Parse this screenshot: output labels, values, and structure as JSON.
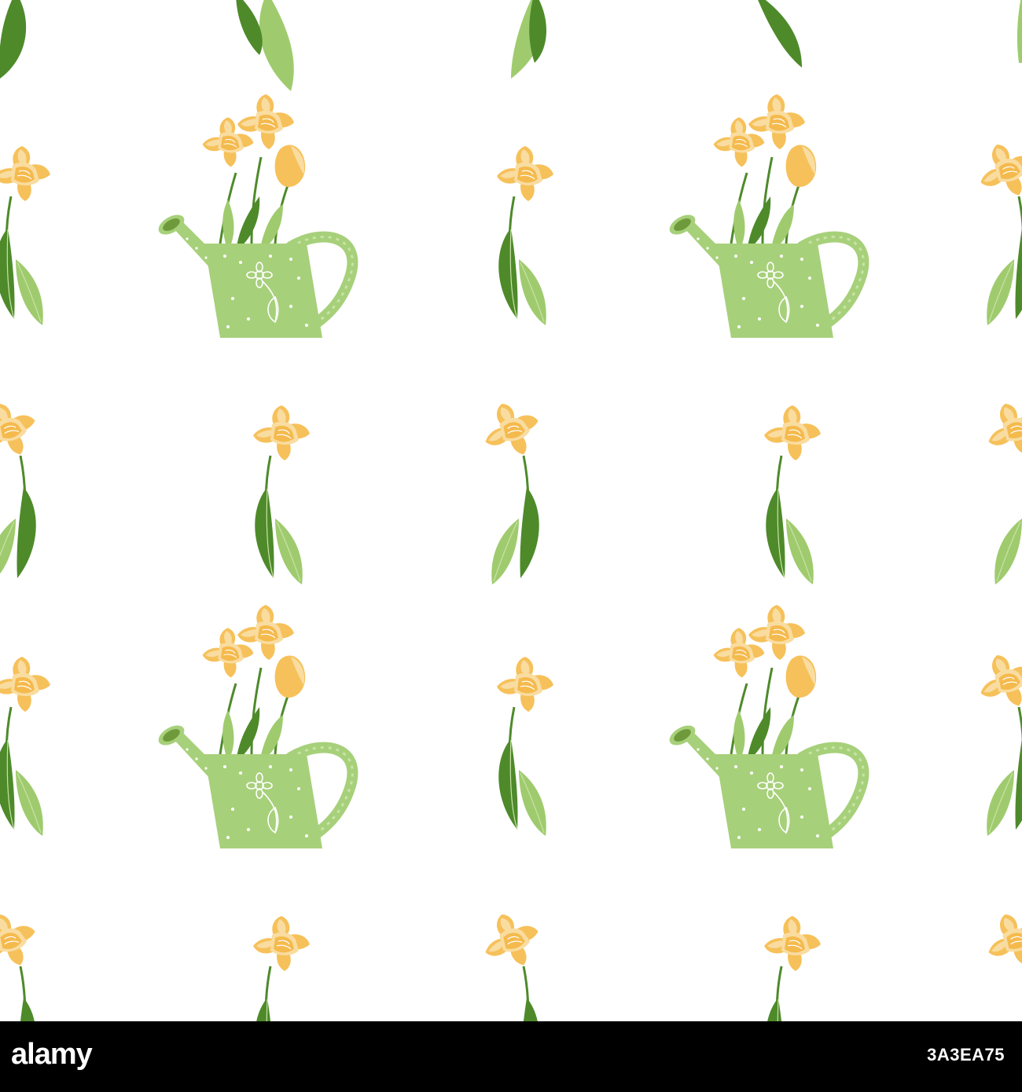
{
  "pattern": {
    "background": "#ffffff",
    "colors": {
      "leaf_dark": "#4e8a2a",
      "leaf_light": "#9fcb6e",
      "leaf_vein": "#c9e3a6",
      "petal_outer": "#f6c15a",
      "petal_light": "#f9dca0",
      "trumpet": "#f4b43e",
      "can_body": "#a7d07a",
      "can_spout_hole": "#6f9a3c",
      "can_decor": "#ffffff"
    },
    "motifs": [
      "watering-can-bouquet",
      "daffodil-sprig"
    ]
  },
  "footer": {
    "background": "#000000",
    "logo_text": "alamy",
    "image_id": "3A3EA75"
  }
}
